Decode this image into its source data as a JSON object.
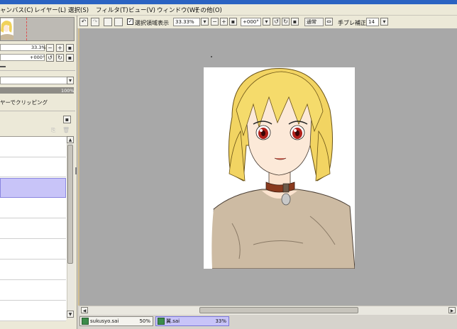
{
  "menu": {
    "items": [
      "ャンバス(C)",
      "レイヤー(L)",
      "選択(S)",
      "フィルタ(T)",
      "ビュー(V)",
      "ウィンドウ(W)",
      "その他(O)"
    ]
  },
  "navigator": {
    "zoom_value": "33.3%",
    "rotation_value": "+000°"
  },
  "layer_panel": {
    "opacity_value": "100%",
    "clipping_label": "ヤーでクリッピング"
  },
  "toolbar": {
    "selection_display_label": "選択領域表示",
    "zoom_value": "33.33%",
    "rotation_value": "+000°",
    "blend_mode": "通常",
    "stabilizer_label": "手ブレ補正",
    "stabilizer_value": "14"
  },
  "tabs": [
    {
      "name": "sukusyo.sai",
      "zoom": "50%"
    },
    {
      "name": "翼.sai",
      "zoom": "33%"
    }
  ],
  "colors": {
    "canvas_bg": "#a8a8a8",
    "panel_bg": "#ece9d8",
    "selected_layer": "#c8c4f8",
    "active_tab": "#c8c4f8"
  }
}
